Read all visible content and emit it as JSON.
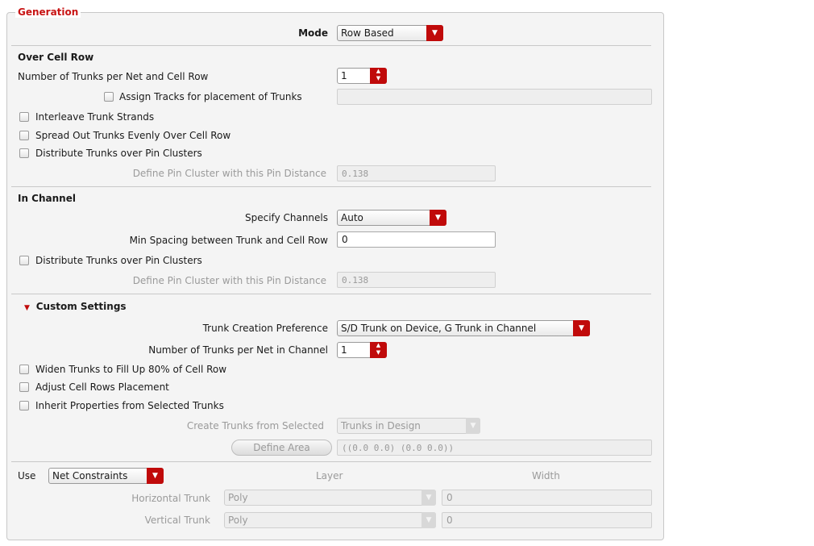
{
  "panel_title": "Generation",
  "mode": {
    "label": "Mode",
    "value": "Row Based"
  },
  "over_cell_row": {
    "heading": "Over Cell Row",
    "trunks_per_net_label": "Number of Trunks per Net and Cell Row",
    "trunks_per_net_value": "1",
    "assign_tracks_label": "Assign Tracks for placement of Trunks",
    "interleave_label": "Interleave Trunk Strands",
    "spread_out_label": "Spread Out Trunks Evenly Over Cell Row",
    "distribute_label": "Distribute Trunks over Pin Clusters",
    "pin_distance_label": "Define Pin Cluster with this Pin Distance",
    "pin_distance_value": "0.138"
  },
  "in_channel": {
    "heading": "In Channel",
    "specify_channels_label": "Specify Channels",
    "specify_channels_value": "Auto",
    "min_spacing_label": "Min Spacing between Trunk and Cell Row",
    "min_spacing_value": "0",
    "distribute_label": "Distribute Trunks over Pin Clusters",
    "pin_distance_label": "Define Pin Cluster with this Pin Distance",
    "pin_distance_value": "0.138"
  },
  "custom_settings": {
    "heading": "Custom Settings",
    "trunk_pref_label": "Trunk Creation Preference",
    "trunk_pref_value": "S/D Trunk on Device, G Trunk in Channel",
    "trunks_in_channel_label": "Number of Trunks per Net in Channel",
    "trunks_in_channel_value": "1",
    "widen_label": "Widen Trunks to Fill Up 80% of Cell Row",
    "adjust_label": "Adjust Cell Rows Placement",
    "inherit_label": "Inherit Properties from Selected Trunks",
    "create_from_label": "Create Trunks from Selected",
    "create_from_value": "Trunks in Design",
    "define_area_label": "Define Area",
    "define_area_value": "((0.0 0.0) (0.0 0.0))"
  },
  "constraints": {
    "use_label": "Use",
    "use_value": "Net Constraints",
    "layer_header": "Layer",
    "width_header": "Width",
    "horizontal_label": "Horizontal Trunk",
    "horizontal_layer": "Poly",
    "horizontal_width": "0",
    "vertical_label": "Vertical Trunk",
    "vertical_layer": "Poly",
    "vertical_width": "0"
  },
  "colors": {
    "accent": "#c00a0a",
    "title": "#c81414",
    "panel_bg": "#f4f4f4"
  }
}
